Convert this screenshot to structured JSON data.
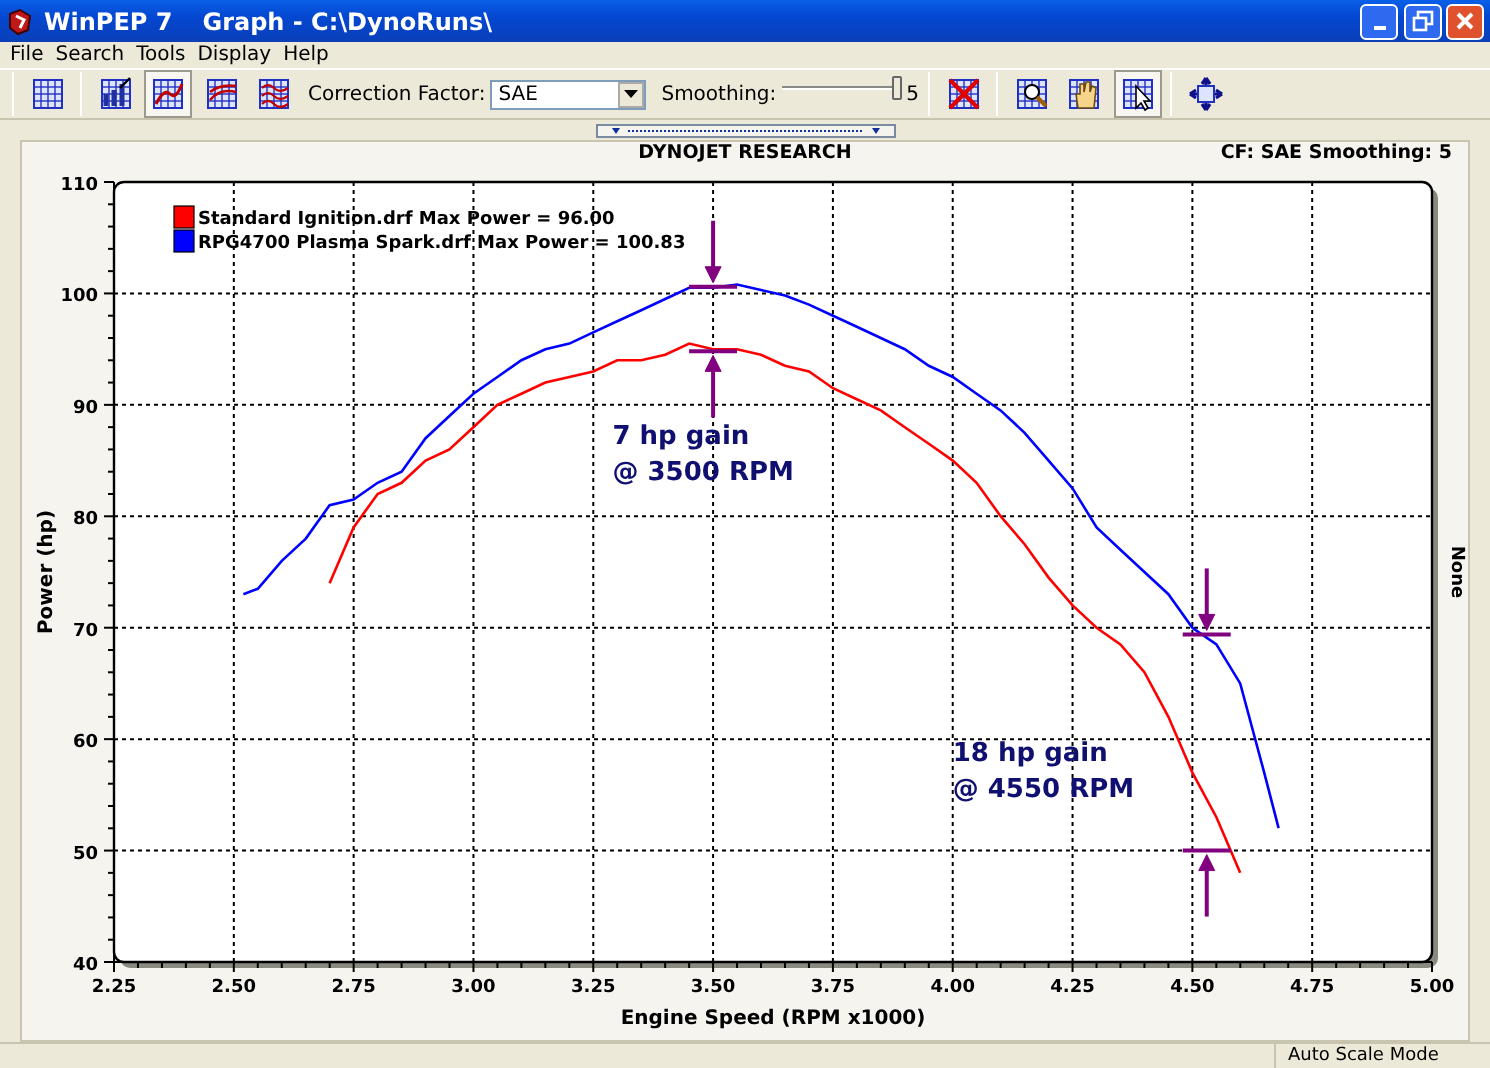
{
  "window": {
    "app": "WinPEP 7",
    "document": "Graph - C:\\DynoRuns\\"
  },
  "menu": [
    "File",
    "Search",
    "Tools",
    "Display",
    "Help"
  ],
  "toolbar": {
    "tools_left": [
      {
        "kind": "grid",
        "pressed": false
      },
      {
        "kind": "bars",
        "pressed": false
      },
      {
        "kind": "line",
        "pressed": true
      },
      {
        "kind": "lines",
        "pressed": false
      },
      {
        "kind": "waves",
        "pressed": false
      }
    ],
    "correction_label": "Correction Factor:",
    "correction_value": "SAE",
    "smoothing_label": "Smoothing:",
    "smoothing_slider": {
      "level": 1.0
    },
    "smoothing_value": "5",
    "tools_right": [
      {
        "kind": "delete",
        "pressed": false
      },
      {
        "kind": "zoom",
        "pressed": false
      },
      {
        "kind": "hand",
        "pressed": false
      },
      {
        "kind": "pointer",
        "pressed": true
      },
      {
        "kind": "axes",
        "pressed": false
      }
    ]
  },
  "graph": {
    "header": "DYNOJET RESEARCH",
    "info": "CF: SAE  Smoothing: 5",
    "right_axis_label": "None",
    "chart_data": {
      "type": "line",
      "xlabel": "Engine Speed (RPM x1000)",
      "ylabel": "Power (hp)",
      "xlim": [
        2.25,
        5.0
      ],
      "ylim": [
        40,
        110
      ],
      "xticks": [
        {
          "value": 2.25,
          "label": "2.25"
        },
        {
          "value": 2.5,
          "label": "2.50"
        },
        {
          "value": 2.75,
          "label": "2.75"
        },
        {
          "value": 3.0,
          "label": "3.00"
        },
        {
          "value": 3.25,
          "label": "3.25"
        },
        {
          "value": 3.5,
          "label": "3.50"
        },
        {
          "value": 3.75,
          "label": "3.75"
        },
        {
          "value": 4.0,
          "label": "4.00"
        },
        {
          "value": 4.25,
          "label": "4.25"
        },
        {
          "value": 4.5,
          "label": "4.50"
        },
        {
          "value": 4.75,
          "label": "4.75"
        },
        {
          "value": 5.0,
          "label": "5.00"
        }
      ],
      "yticks": [
        40,
        50,
        60,
        70,
        80,
        90,
        100,
        110
      ],
      "x": [
        2.52,
        2.55,
        2.6,
        2.65,
        2.7,
        2.75,
        2.8,
        2.85,
        2.9,
        2.95,
        3.0,
        3.05,
        3.1,
        3.15,
        3.2,
        3.25,
        3.3,
        3.35,
        3.4,
        3.45,
        3.5,
        3.55,
        3.6,
        3.65,
        3.7,
        3.75,
        3.8,
        3.85,
        3.9,
        3.95,
        4.0,
        4.05,
        4.1,
        4.15,
        4.2,
        4.25,
        4.3,
        4.35,
        4.4,
        4.45,
        4.5,
        4.55,
        4.6,
        4.65,
        4.68
      ],
      "series": [
        {
          "name": "Standard Ignition.drf Max Power = 96.00",
          "color": "#ff0000",
          "values": [
            null,
            null,
            null,
            null,
            74,
            79,
            82,
            83,
            85,
            86,
            88,
            90,
            91,
            92,
            92.5,
            93,
            94,
            94,
            94.5,
            95.5,
            95,
            95,
            94.5,
            93.5,
            93,
            91.5,
            90.5,
            89.5,
            88,
            86.5,
            85,
            83,
            80,
            77.5,
            74.5,
            72,
            70,
            68.5,
            66,
            62,
            57,
            53,
            48,
            null,
            null
          ]
        },
        {
          "name": "RPG4700 Plasma Spark.drf Max Power = 100.83",
          "color": "#0000ff",
          "values": [
            73,
            73.5,
            76,
            78,
            81,
            81.5,
            83,
            84,
            87,
            89,
            91,
            92.5,
            94,
            95,
            95.5,
            96.5,
            97.5,
            98.5,
            99.5,
            100.5,
            100.5,
            100.8,
            100.3,
            99.8,
            99,
            98,
            97,
            96,
            95,
            93.5,
            92.5,
            91,
            89.5,
            87.5,
            85,
            82.5,
            79,
            77,
            75,
            73,
            70,
            68.5,
            65,
            57,
            52
          ]
        }
      ],
      "grid": true,
      "legend": true,
      "annotations": [
        "7 hp gain",
        "@ 3500 RPM",
        "18 hp gain",
        "@ 4550 RPM"
      ]
    },
    "gain_markers": [
      {
        "kind": "down"
      },
      {
        "kind": "up"
      },
      {
        "kind": "down"
      },
      {
        "kind": "up"
      }
    ]
  },
  "status_bar": {
    "mode": "Auto Scale Mode"
  }
}
